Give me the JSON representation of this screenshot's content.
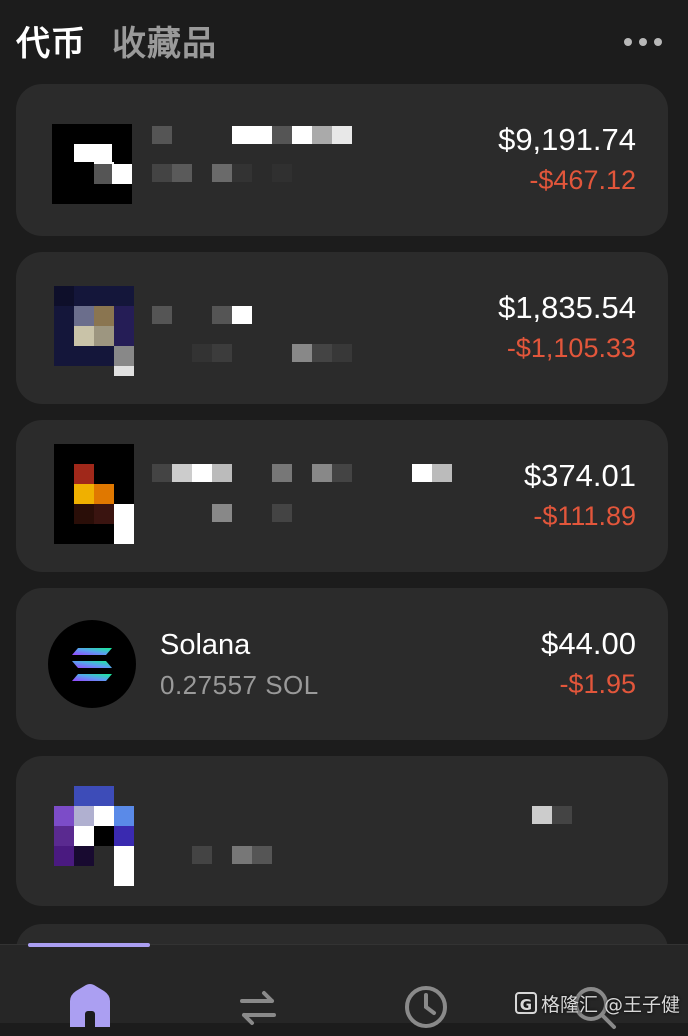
{
  "header": {
    "tabs": [
      {
        "label": "代币",
        "active": true
      },
      {
        "label": "收藏品",
        "active": false
      }
    ],
    "more_icon": "more-horizontal-icon"
  },
  "tokens": [
    {
      "name": "",
      "price": "$9,191.74",
      "change": "-$467.12",
      "icon": "pixelated-token-icon"
    },
    {
      "name": "",
      "price": "$1,835.54",
      "change": "-$1,105.33",
      "icon": "pixelated-token-icon"
    },
    {
      "name": "",
      "price": "$374.01",
      "change": "-$111.89",
      "icon": "pixelated-token-icon"
    },
    {
      "name": "Solana",
      "amount": "0.27557 SOL",
      "price": "$44.00",
      "change": "-$1.95",
      "icon": "solana-logo-icon"
    },
    {
      "name": "",
      "price": "",
      "change": "",
      "icon": "pixelated-token-icon"
    }
  ],
  "colors": {
    "background": "#1c1c1c",
    "card": "#2b2b2b",
    "negative": "#e2563b",
    "accent": "#ab9ff2",
    "secondary_text": "#9a9a9a"
  },
  "bottom_nav": {
    "items": [
      {
        "name": "home",
        "icon": "home-icon",
        "active": true
      },
      {
        "name": "swap",
        "icon": "swap-icon",
        "active": false
      },
      {
        "name": "history",
        "icon": "clock-icon",
        "active": false
      },
      {
        "name": "search",
        "icon": "search-icon",
        "active": false
      }
    ]
  },
  "watermark": {
    "text": "格隆汇 @王子健"
  }
}
